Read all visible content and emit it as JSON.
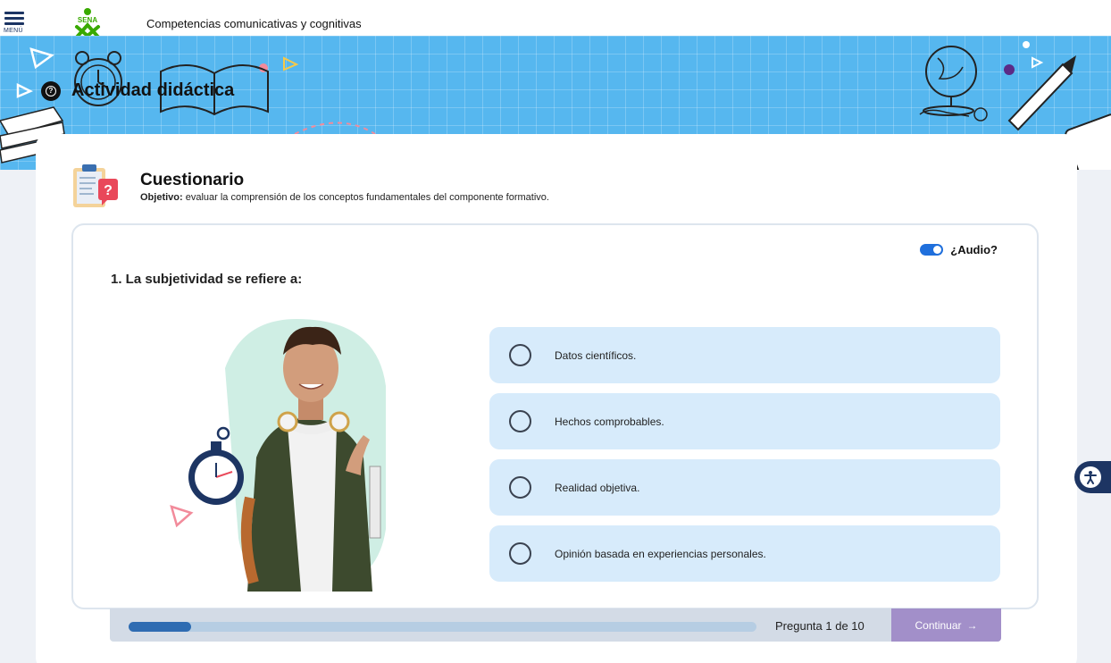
{
  "header": {
    "menu_label": "MENÚ",
    "logo_text": "SENA",
    "course_title": "Competencias comunicativas y cognitivas"
  },
  "banner": {
    "title": "Actividad didáctica"
  },
  "quiz": {
    "title": "Cuestionario",
    "objective_label": "Objetivo:",
    "objective_text": " evaluar la comprensión de los conceptos fundamentales del componente formativo.",
    "audio_label": "¿Audio?",
    "audio_enabled": true,
    "question": "1. La subjetividad se refiere a:",
    "options": [
      {
        "label": "Datos científicos."
      },
      {
        "label": "Hechos comprobables."
      },
      {
        "label": "Realidad objetiva."
      },
      {
        "label": "Opinión basada en experiencias personales."
      }
    ]
  },
  "progress": {
    "counter": "Pregunta 1 de 10",
    "fraction": 0.1,
    "continue_label": "Continuar"
  },
  "colors": {
    "banner": "#56b7ef",
    "option_bg": "#d7ebfb",
    "progress_fill": "#2f6cb2",
    "continue_bg": "#a28fc9",
    "brand_green": "#39a900",
    "navy": "#1d3563"
  },
  "icons": {
    "menu": "hamburger-icon",
    "help": "help-circle-icon",
    "quiz": "clipboard-question-icon",
    "accessibility": "accessibility-icon",
    "continue": "arrow-right-icon"
  }
}
